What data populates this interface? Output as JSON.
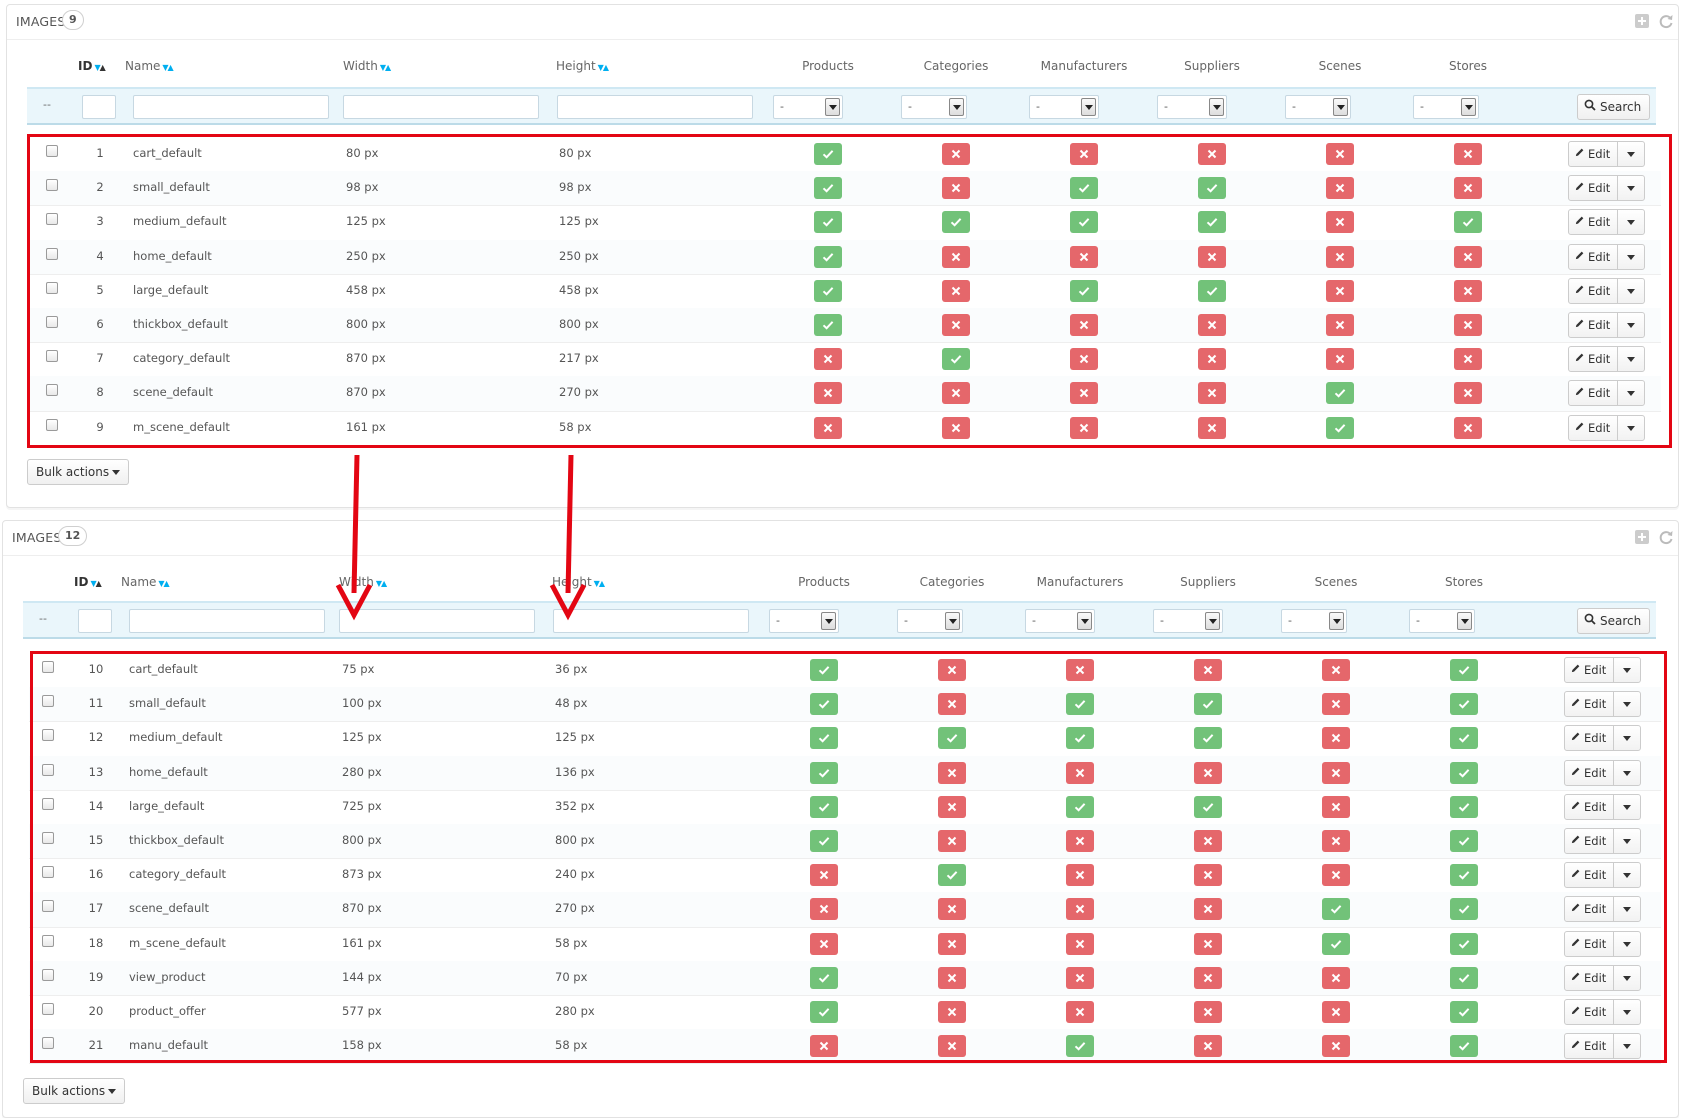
{
  "columns": {
    "id": "ID",
    "name": "Name",
    "width": "Width",
    "height": "Height",
    "products": "Products",
    "categories": "Categories",
    "manufacturers": "Manufacturers",
    "suppliers": "Suppliers",
    "scenes": "Scenes",
    "stores": "Stores"
  },
  "filter": {
    "dash": "--",
    "select_value": "-",
    "search_label": "Search"
  },
  "row_actions": {
    "edit_label": "Edit"
  },
  "bulk_label": "Bulk actions",
  "colors": {
    "ok": "#72c279",
    "no": "#e5676b",
    "highlight": "#e30613",
    "accent": "#00aff0"
  },
  "icons": {
    "ok": "check-icon",
    "no": "cross-icon",
    "edit": "pencil-icon",
    "search": "search-icon",
    "add": "add-icon",
    "refresh": "refresh-icon"
  },
  "panels": [
    {
      "title": "IMAGES",
      "count": "9",
      "rows": [
        {
          "id": "1",
          "name": "cart_default",
          "width": "80 px",
          "height": "80 px",
          "flags": [
            1,
            0,
            0,
            0,
            0,
            0
          ]
        },
        {
          "id": "2",
          "name": "small_default",
          "width": "98 px",
          "height": "98 px",
          "flags": [
            1,
            0,
            1,
            1,
            0,
            0
          ]
        },
        {
          "id": "3",
          "name": "medium_default",
          "width": "125 px",
          "height": "125 px",
          "flags": [
            1,
            1,
            1,
            1,
            0,
            1
          ]
        },
        {
          "id": "4",
          "name": "home_default",
          "width": "250 px",
          "height": "250 px",
          "flags": [
            1,
            0,
            0,
            0,
            0,
            0
          ]
        },
        {
          "id": "5",
          "name": "large_default",
          "width": "458 px",
          "height": "458 px",
          "flags": [
            1,
            0,
            1,
            1,
            0,
            0
          ]
        },
        {
          "id": "6",
          "name": "thickbox_default",
          "width": "800 px",
          "height": "800 px",
          "flags": [
            1,
            0,
            0,
            0,
            0,
            0
          ]
        },
        {
          "id": "7",
          "name": "category_default",
          "width": "870 px",
          "height": "217 px",
          "flags": [
            0,
            1,
            0,
            0,
            0,
            0
          ]
        },
        {
          "id": "8",
          "name": "scene_default",
          "width": "870 px",
          "height": "270 px",
          "flags": [
            0,
            0,
            0,
            0,
            1,
            0
          ]
        },
        {
          "id": "9",
          "name": "m_scene_default",
          "width": "161 px",
          "height": "58 px",
          "flags": [
            0,
            0,
            0,
            0,
            1,
            0
          ]
        }
      ]
    },
    {
      "title": "IMAGES",
      "count": "12",
      "rows": [
        {
          "id": "10",
          "name": "cart_default",
          "width": "75 px",
          "height": "36 px",
          "flags": [
            1,
            0,
            0,
            0,
            0,
            1
          ]
        },
        {
          "id": "11",
          "name": "small_default",
          "width": "100 px",
          "height": "48 px",
          "flags": [
            1,
            0,
            1,
            1,
            0,
            1
          ]
        },
        {
          "id": "12",
          "name": "medium_default",
          "width": "125 px",
          "height": "125 px",
          "flags": [
            1,
            1,
            1,
            1,
            0,
            1
          ]
        },
        {
          "id": "13",
          "name": "home_default",
          "width": "280 px",
          "height": "136 px",
          "flags": [
            1,
            0,
            0,
            0,
            0,
            1
          ]
        },
        {
          "id": "14",
          "name": "large_default",
          "width": "725 px",
          "height": "352 px",
          "flags": [
            1,
            0,
            1,
            1,
            0,
            1
          ]
        },
        {
          "id": "15",
          "name": "thickbox_default",
          "width": "800 px",
          "height": "800 px",
          "flags": [
            1,
            0,
            0,
            0,
            0,
            1
          ]
        },
        {
          "id": "16",
          "name": "category_default",
          "width": "873 px",
          "height": "240 px",
          "flags": [
            0,
            1,
            0,
            0,
            0,
            1
          ]
        },
        {
          "id": "17",
          "name": "scene_default",
          "width": "870 px",
          "height": "270 px",
          "flags": [
            0,
            0,
            0,
            0,
            1,
            1
          ]
        },
        {
          "id": "18",
          "name": "m_scene_default",
          "width": "161 px",
          "height": "58 px",
          "flags": [
            0,
            0,
            0,
            0,
            1,
            1
          ]
        },
        {
          "id": "19",
          "name": "view_product",
          "width": "144 px",
          "height": "70 px",
          "flags": [
            1,
            0,
            0,
            0,
            0,
            1
          ]
        },
        {
          "id": "20",
          "name": "product_offer",
          "width": "577 px",
          "height": "280 px",
          "flags": [
            1,
            0,
            0,
            0,
            0,
            1
          ]
        },
        {
          "id": "21",
          "name": "manu_default",
          "width": "158 px",
          "height": "58 px",
          "flags": [
            0,
            0,
            1,
            0,
            0,
            1
          ]
        }
      ]
    }
  ]
}
